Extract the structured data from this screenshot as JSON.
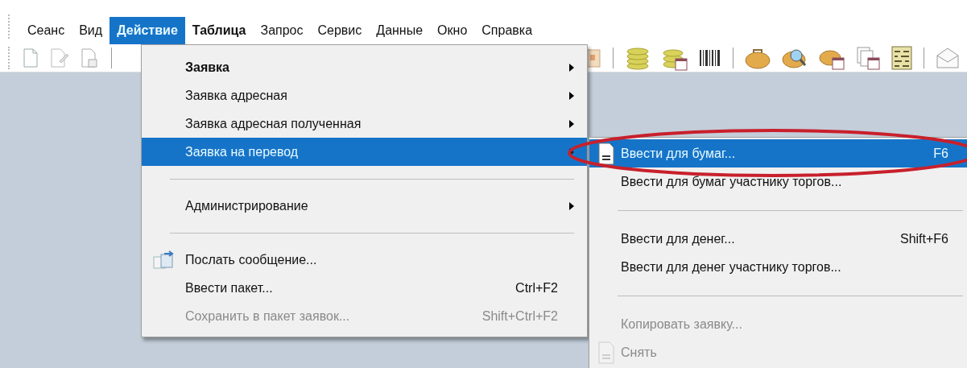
{
  "menu_bar": [
    {
      "label": "Сеанс",
      "selected": false,
      "bold": false
    },
    {
      "label": "Вид",
      "selected": false,
      "bold": false
    },
    {
      "label": "Действие",
      "selected": true,
      "bold": false
    },
    {
      "label": "Таблица",
      "selected": false,
      "bold": true
    },
    {
      "label": "Запрос",
      "selected": false,
      "bold": false
    },
    {
      "label": "Сервис",
      "selected": false,
      "bold": false
    },
    {
      "label": "Данные",
      "selected": false,
      "bold": false
    },
    {
      "label": "Окно",
      "selected": false,
      "bold": false
    },
    {
      "label": "Справка",
      "selected": false,
      "bold": false
    }
  ],
  "action_menu": {
    "items": [
      {
        "kind": "item",
        "label": "Заявка",
        "bold": true,
        "submenu": true,
        "selected": false,
        "disabled": false,
        "icon": false
      },
      {
        "kind": "item",
        "label": "Заявка адресная",
        "bold": false,
        "submenu": true,
        "selected": false,
        "disabled": false,
        "icon": false
      },
      {
        "kind": "item",
        "label": "Заявка адресная полученная",
        "bold": false,
        "submenu": true,
        "selected": false,
        "disabled": false,
        "icon": false
      },
      {
        "kind": "item",
        "label": "Заявка на перевод",
        "bold": false,
        "submenu": true,
        "selected": true,
        "disabled": false,
        "icon": false
      },
      {
        "kind": "separator"
      },
      {
        "kind": "item",
        "label": "Администрирование",
        "bold": false,
        "submenu": true,
        "selected": false,
        "disabled": false,
        "icon": false
      },
      {
        "kind": "separator"
      },
      {
        "kind": "item",
        "label": "Послать сообщение...",
        "bold": false,
        "submenu": false,
        "selected": false,
        "disabled": false,
        "icon": true
      },
      {
        "kind": "item",
        "label": "Ввести пакет...",
        "shortcut": "Ctrl+F2",
        "bold": false,
        "submenu": false,
        "selected": false,
        "disabled": false,
        "icon": false
      },
      {
        "kind": "item",
        "label": "Сохранить в пакет заявок...",
        "shortcut": "Shift+Ctrl+F2",
        "bold": false,
        "submenu": false,
        "selected": false,
        "disabled": true,
        "icon": false
      }
    ]
  },
  "transfer_submenu": {
    "items": [
      {
        "kind": "item",
        "label": "Ввести для бумаг...",
        "shortcut": "F6",
        "selected": true,
        "disabled": false,
        "icon": true
      },
      {
        "kind": "item",
        "label": "Ввести для бумаг участнику торгов...",
        "selected": false,
        "disabled": false,
        "icon": false
      },
      {
        "kind": "separator"
      },
      {
        "kind": "item",
        "label": "Ввести для денег...",
        "shortcut": "Shift+F6",
        "selected": false,
        "disabled": false,
        "icon": false
      },
      {
        "kind": "item",
        "label": "Ввести для денег участнику торгов...",
        "selected": false,
        "disabled": false,
        "icon": false
      },
      {
        "kind": "separator"
      },
      {
        "kind": "item",
        "label": "Копировать заявку...",
        "selected": false,
        "disabled": true,
        "icon": false
      },
      {
        "kind": "item",
        "label": "Снять",
        "selected": false,
        "disabled": true,
        "icon": true
      }
    ]
  }
}
